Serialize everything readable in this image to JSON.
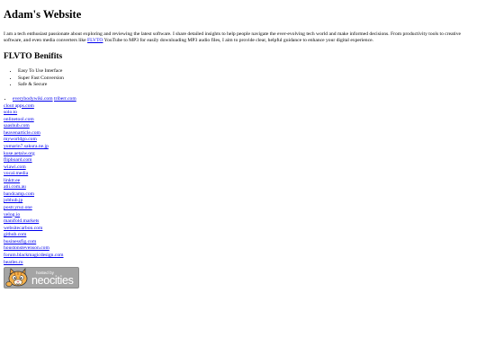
{
  "header": {
    "title": "Adam's Website"
  },
  "intro": {
    "before_link": "I am a tech enthusiast passionate about exploring and reviewing the latest software. I share detailed insights to help people navigate the ever-evolving tech world and make informed decisions. From productivity tools to creative software, and even media converters like ",
    "link_text": "FLVTO",
    "after_link": " YouTube to MP3 for easily downloading MP3 audio files, I aim to provide clear, helpful guidance to enhance your digital experience."
  },
  "benefits": {
    "heading": "FLVTO Benifits",
    "items": [
      "Easy To Use Interface",
      "Super Fast Conversion",
      "Safe & Secure"
    ]
  },
  "links": {
    "first_row": [
      "everybodywiki.com",
      "triberr.com"
    ],
    "list": [
      "clout apps.com",
      "solo.to",
      "onlinetool.com",
      "saashub.com",
      "heavenarticle.com",
      "myworldgo.com",
      "yumarin7.sakura.ne.jp",
      "kuse.aetaiw.org",
      "flipboard.com",
      "wiawi.com",
      "vocal.media",
      "linktr.ee",
      "atii.com.au",
      "bandcamp.com",
      "jobhub.jp",
      "postr.yruz.one",
      "velog.io",
      "manifold.markets",
      "websitecarbon.com",
      "github.com",
      "businessfig.com",
      "houstonstevenson.com",
      "forum.blackmagicdesign.com",
      "beatles.ru"
    ]
  },
  "badge": {
    "hosted_label": "hosted by",
    "brand": "neocities",
    "icon": "neocities-cat-icon"
  },
  "colors": {
    "link": "#0000ee",
    "text": "#000000",
    "background": "#ffffff",
    "badge": "#a4a4a4"
  }
}
